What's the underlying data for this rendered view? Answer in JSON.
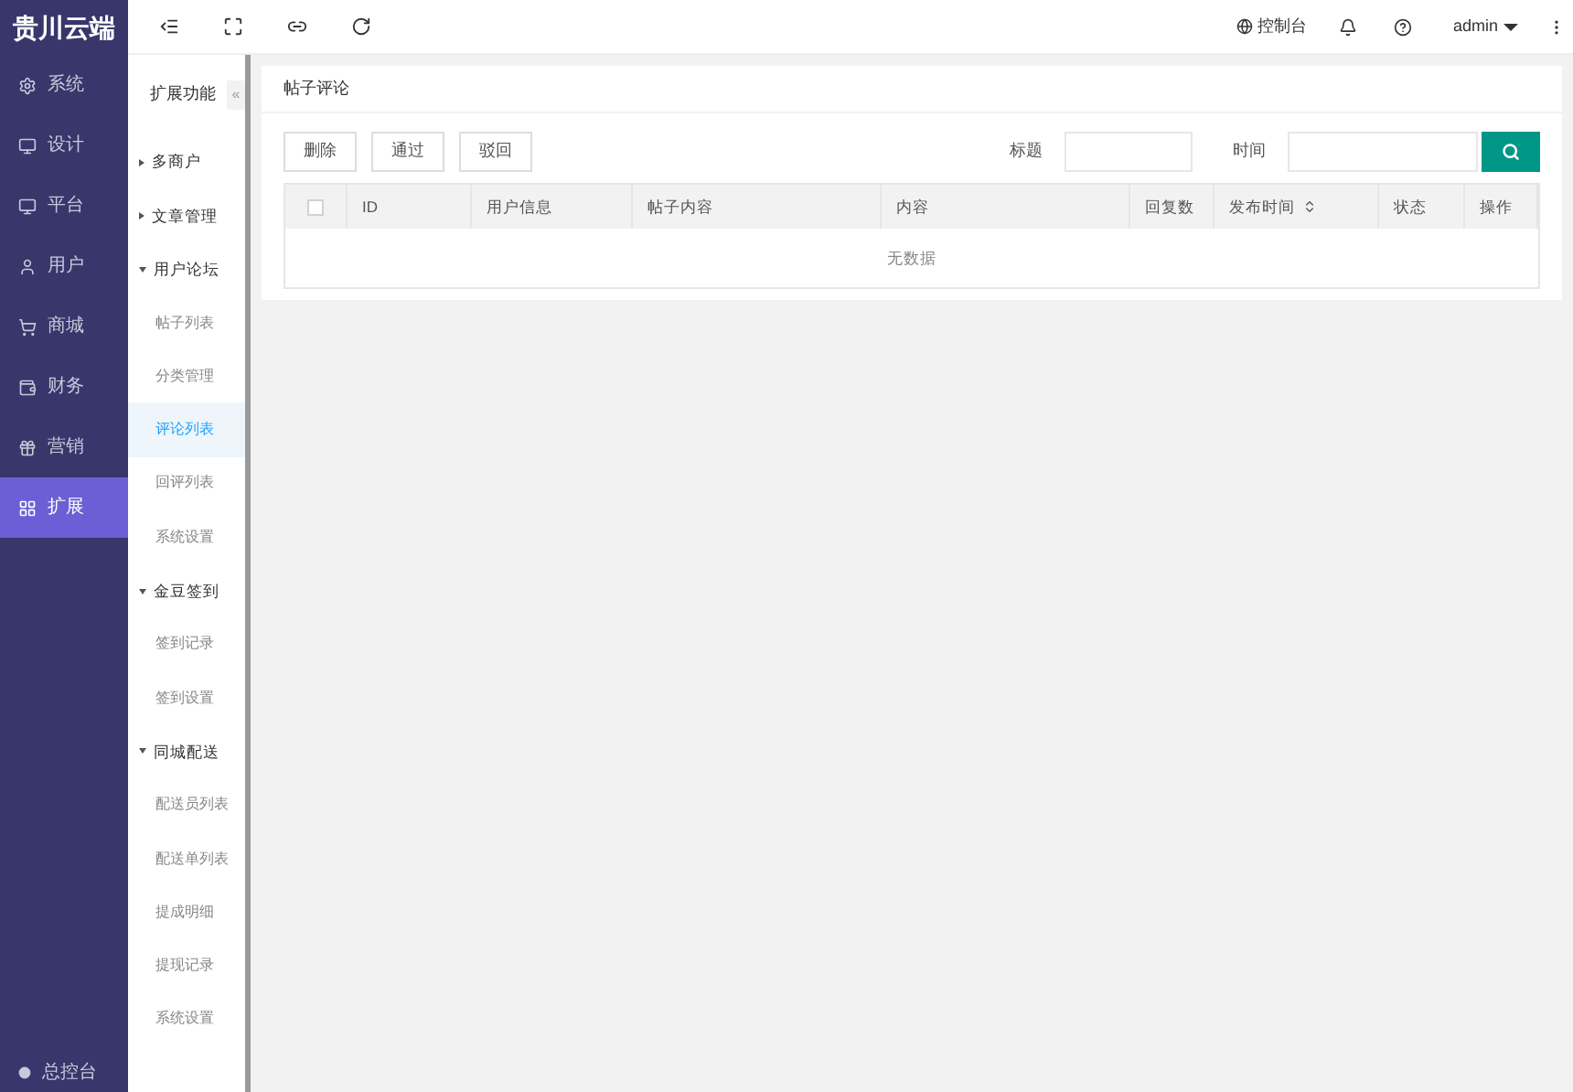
{
  "brand": "贵川云端",
  "main_nav": [
    {
      "label": "系统",
      "selected": false
    },
    {
      "label": "设计",
      "selected": false
    },
    {
      "label": "平台",
      "selected": false
    },
    {
      "label": "用户",
      "selected": false
    },
    {
      "label": "商城",
      "selected": false
    },
    {
      "label": "财务",
      "selected": false
    },
    {
      "label": "营销",
      "selected": false
    },
    {
      "label": "扩展",
      "selected": true
    }
  ],
  "main_nav_footer": "总控台",
  "submenu": {
    "title": "扩展功能",
    "collapse": "«",
    "groups": [
      {
        "label": "多商户",
        "expanded": false
      },
      {
        "label": "文章管理",
        "expanded": false
      },
      {
        "label": "用户论坛",
        "expanded": true,
        "children": [
          {
            "label": "帖子列表",
            "selected": false
          },
          {
            "label": "分类管理",
            "selected": false
          },
          {
            "label": "评论列表",
            "selected": true
          },
          {
            "label": "回评列表",
            "selected": false
          },
          {
            "label": "系统设置",
            "selected": false
          }
        ]
      },
      {
        "label": "金豆签到",
        "expanded": true,
        "children": [
          {
            "label": "签到记录",
            "selected": false
          },
          {
            "label": "签到设置",
            "selected": false
          }
        ]
      },
      {
        "label": "同城配送",
        "expanded": true,
        "children": [
          {
            "label": "配送员列表",
            "selected": false
          },
          {
            "label": "配送单列表",
            "selected": false
          },
          {
            "label": "提成明细",
            "selected": false
          },
          {
            "label": "提现记录",
            "selected": false
          },
          {
            "label": "系统设置",
            "selected": false
          }
        ]
      }
    ]
  },
  "topbar": {
    "console": "控制台",
    "user": "admin"
  },
  "panel": {
    "title": "帖子评论",
    "buttons": [
      "删除",
      "通过",
      "驳回"
    ],
    "filters": [
      {
        "label": "标题"
      },
      {
        "label": "时间"
      }
    ],
    "table": {
      "select_all": false,
      "columns": [
        {
          "label": "ID",
          "kind": "plain"
        },
        {
          "label": "用户信息",
          "kind": "plain"
        },
        {
          "label": "帖子内容",
          "kind": "plain"
        },
        {
          "label": "内容",
          "kind": "plain"
        },
        {
          "label": "回复数",
          "kind": "plain"
        },
        {
          "label": "发布时间",
          "kind": "sortable"
        },
        {
          "label": "状态",
          "kind": "plain"
        },
        {
          "label": "操作",
          "kind": "plain"
        }
      ],
      "empty": "无数据"
    }
  }
}
